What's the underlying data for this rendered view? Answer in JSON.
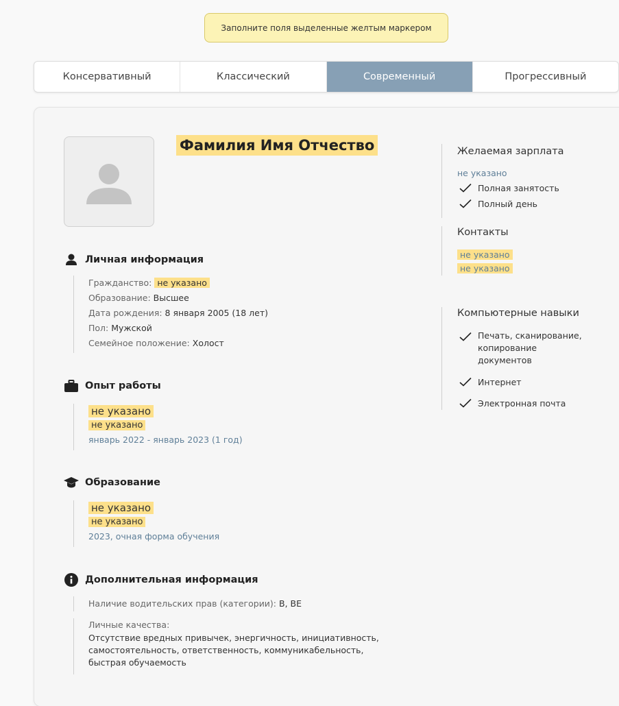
{
  "notice": "Заполните поля выделенные желтым маркером",
  "tabs": [
    {
      "label": "Консервативный",
      "active": false
    },
    {
      "label": "Классический",
      "active": false
    },
    {
      "label": "Современный",
      "active": true
    },
    {
      "label": "Прогрессивный",
      "active": false
    }
  ],
  "colors": {
    "highlight": "#fde08a",
    "tab_active": "#87a0b5",
    "link": "#5f7f98"
  },
  "resume": {
    "full_name": "Фамилия Имя Отчество",
    "personal": {
      "title": "Личная информация",
      "citizenship_label": "Гражданство:",
      "citizenship_value": "не указано",
      "education_label": "Образование:",
      "education_value": "Высшее",
      "birth_label": "Дата рождения:",
      "birth_value": "8 января 2005 (18 лет)",
      "gender_label": "Пол:",
      "gender_value": "Мужской",
      "marital_label": "Семейное положение:",
      "marital_value": "Холост"
    },
    "experience": {
      "title": "Опыт работы",
      "position": "не указано",
      "company": "не указано",
      "period": "январь 2022 - январь 2023 (1 год)"
    },
    "education": {
      "title": "Образование",
      "institution": "не указано",
      "specialty": "не указано",
      "period": "2023, очная форма обучения"
    },
    "additional": {
      "title": "Дополнительная информация",
      "license_label": "Наличие водительских прав (категории):",
      "license_value": "B, BE",
      "qualities_label": "Личные качества:",
      "qualities_value": "Отсутствие вредных привычек, энергичность, инициативность, самостоятельность, ответственность, коммуникабельность, быстрая обучаемость"
    }
  },
  "sidebar": {
    "salary_title": "Желаемая зарплата",
    "salary_value": "не указано",
    "employment": [
      "Полная занятость",
      "Полный день"
    ],
    "contacts_title": "Контакты",
    "contacts": [
      "не указано",
      "не указано"
    ],
    "skills_title": "Компьютерные навыки",
    "skills": [
      "Печать, сканирование, копирование документов",
      "Интернет",
      "Электронная почта"
    ]
  }
}
